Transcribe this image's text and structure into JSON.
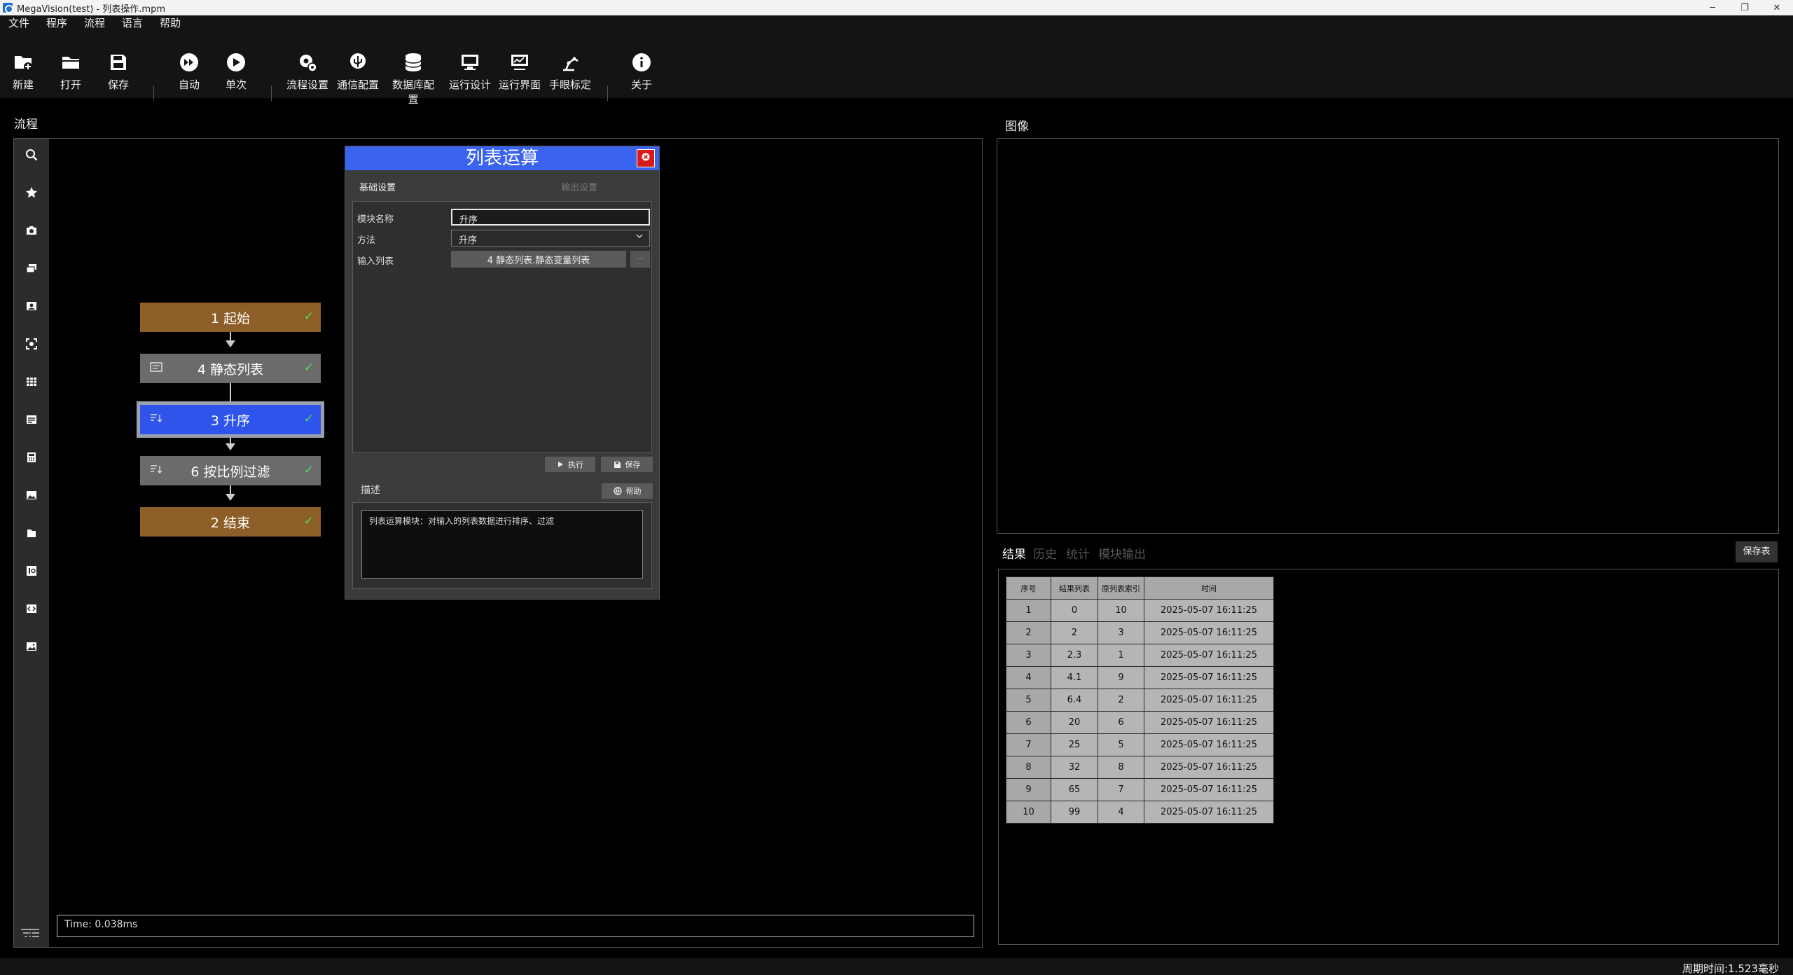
{
  "window": {
    "title": "MegaVision(test) - 列表操作.mpm",
    "controls": {
      "minimize": "─",
      "maximize": "❐",
      "close": "✕"
    }
  },
  "menu": [
    "文件",
    "程序",
    "流程",
    "语言",
    "帮助"
  ],
  "toolbar": {
    "new": "新建",
    "open": "打开",
    "save": "保存",
    "auto": "自动",
    "single": "单次",
    "flow_settings": "流程设置",
    "comm_config": "通信配置",
    "db_config": "数据库配置",
    "run_design": "运行设计",
    "run_ui": "运行界面",
    "hand_eye": "手眼标定",
    "about": "关于"
  },
  "flow": {
    "title": "流程",
    "nodes": [
      {
        "label": "1 起始",
        "check": "✓"
      },
      {
        "label": "4 静态列表",
        "check": "✓"
      },
      {
        "label": "3 升序",
        "check": "✓"
      },
      {
        "label": "6 按比例过滤",
        "check": "✓"
      },
      {
        "label": "2 结束",
        "check": "✓"
      }
    ],
    "time_text": "Time: 0.038ms"
  },
  "dialog": {
    "title": "列表运算",
    "tabs": {
      "basic": "基础设置",
      "output": "输出设置"
    },
    "fields": {
      "module_name_label": "模块名称",
      "module_name_value": "升序",
      "method_label": "方法",
      "method_value": "升序",
      "input_list_label": "输入列表",
      "input_list_value": "4 静态列表.静态变量列表",
      "input_list_btn": "···"
    },
    "run_btn": "执行",
    "save_btn": "保存",
    "desc_label": "描述",
    "help_btn": "帮助",
    "description": "列表运算模块：对输入的列表数据进行排序、过滤"
  },
  "image": {
    "title": "图像"
  },
  "results": {
    "tabs": {
      "result": "结果",
      "history": "历史",
      "stats": "统计",
      "module_output": "模块输出"
    },
    "save_table": "保存表",
    "columns": [
      "序号",
      "结果列表",
      "原列表索引",
      "时间"
    ],
    "rows": [
      [
        "1",
        "0",
        "10",
        "2025-05-07 16:11:25"
      ],
      [
        "2",
        "2",
        "3",
        "2025-05-07 16:11:25"
      ],
      [
        "3",
        "2.3",
        "1",
        "2025-05-07 16:11:25"
      ],
      [
        "4",
        "4.1",
        "9",
        "2025-05-07 16:11:25"
      ],
      [
        "5",
        "6.4",
        "2",
        "2025-05-07 16:11:25"
      ],
      [
        "6",
        "20",
        "6",
        "2025-05-07 16:11:25"
      ],
      [
        "7",
        "25",
        "5",
        "2025-05-07 16:11:25"
      ],
      [
        "8",
        "32",
        "8",
        "2025-05-07 16:11:25"
      ],
      [
        "9",
        "65",
        "7",
        "2025-05-07 16:11:25"
      ],
      [
        "10",
        "99",
        "4",
        "2025-05-07 16:11:25"
      ]
    ]
  },
  "status": {
    "cycle_time": "周期时间:1.523毫秒"
  }
}
